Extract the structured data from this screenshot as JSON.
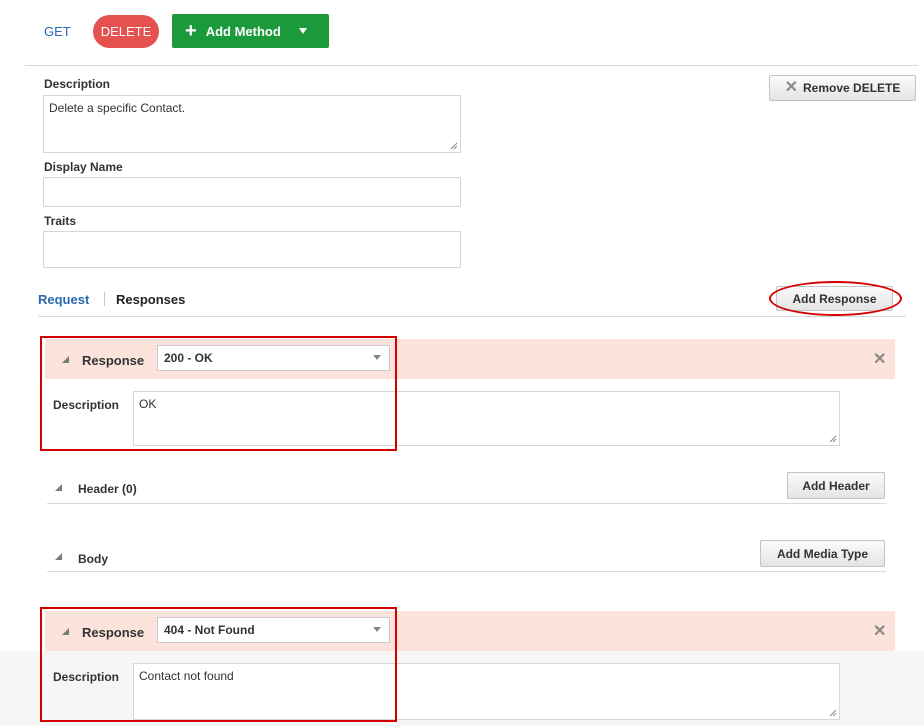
{
  "methods": {
    "get_label": "GET",
    "delete_label": "DELETE",
    "add_method_label": "Add Method"
  },
  "method_form": {
    "description_label": "Description",
    "description_value": "Delete a specific Contact.",
    "display_name_label": "Display Name",
    "display_name_value": "",
    "traits_label": "Traits",
    "traits_value": "",
    "remove_label": "Remove DELETE"
  },
  "tabs": {
    "request_label": "Request",
    "responses_label": "Responses",
    "add_response_label": "Add Response"
  },
  "responses": [
    {
      "label": "Response",
      "code": "200 - OK",
      "description_label": "Description",
      "description_value": "OK"
    },
    {
      "label": "Response",
      "code": "404 - Not Found",
      "description_label": "Description",
      "description_value": "Contact not found"
    }
  ],
  "header_section": {
    "label": "Header (0)",
    "button_label": "Add Header"
  },
  "body_section": {
    "label": "Body",
    "button_label": "Add Media Type"
  },
  "colors": {
    "delete_pill": "#e4514f",
    "add_method": "#1a9a3a",
    "response_bar": "#fce3dc",
    "highlight": "#d40000",
    "link": "#2a6ab0"
  }
}
